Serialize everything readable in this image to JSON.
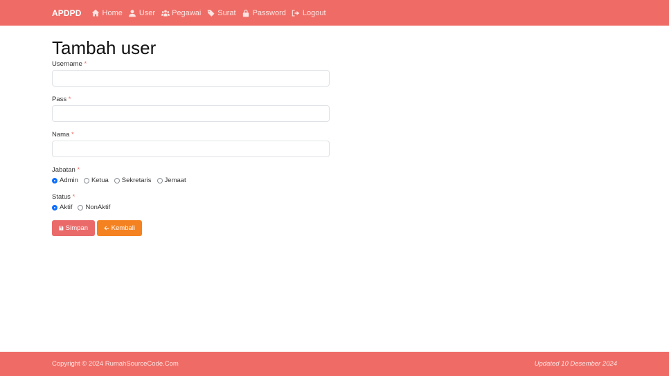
{
  "navbar": {
    "brand": "APDPD",
    "links": [
      {
        "label": "Home",
        "icon": "home-icon"
      },
      {
        "label": "User",
        "icon": "user-icon"
      },
      {
        "label": "Pegawai",
        "icon": "users-icon"
      },
      {
        "label": "Surat",
        "icon": "tags-icon"
      },
      {
        "label": "Password",
        "icon": "lock-icon"
      },
      {
        "label": "Logout",
        "icon": "logout-icon"
      }
    ]
  },
  "form": {
    "title": "Tambah user",
    "required_mark": "*",
    "username": {
      "label": "Username",
      "value": "",
      "placeholder": ""
    },
    "pass": {
      "label": "Pass",
      "value": "",
      "placeholder": ""
    },
    "nama": {
      "label": "Nama",
      "value": "",
      "placeholder": ""
    },
    "jabatan": {
      "label": "Jabatan",
      "options": [
        "Admin",
        "Ketua",
        "Sekretaris",
        "Jemaat"
      ],
      "selected": "Admin"
    },
    "status": {
      "label": "Status",
      "options": [
        "Aktif",
        "NonAktif"
      ],
      "selected": "Aktif"
    },
    "save_label": "Simpan",
    "back_label": "Kembali"
  },
  "footer": {
    "copyright": "Copyright © 2024 RumahSourceCode.Com",
    "updated": "Updated 10 Desember 2024"
  },
  "colors": {
    "primary": "#ef6c66",
    "save_button": "#ea6a6a",
    "back_button": "#f58220",
    "radio_selected": "#0d6efd"
  }
}
